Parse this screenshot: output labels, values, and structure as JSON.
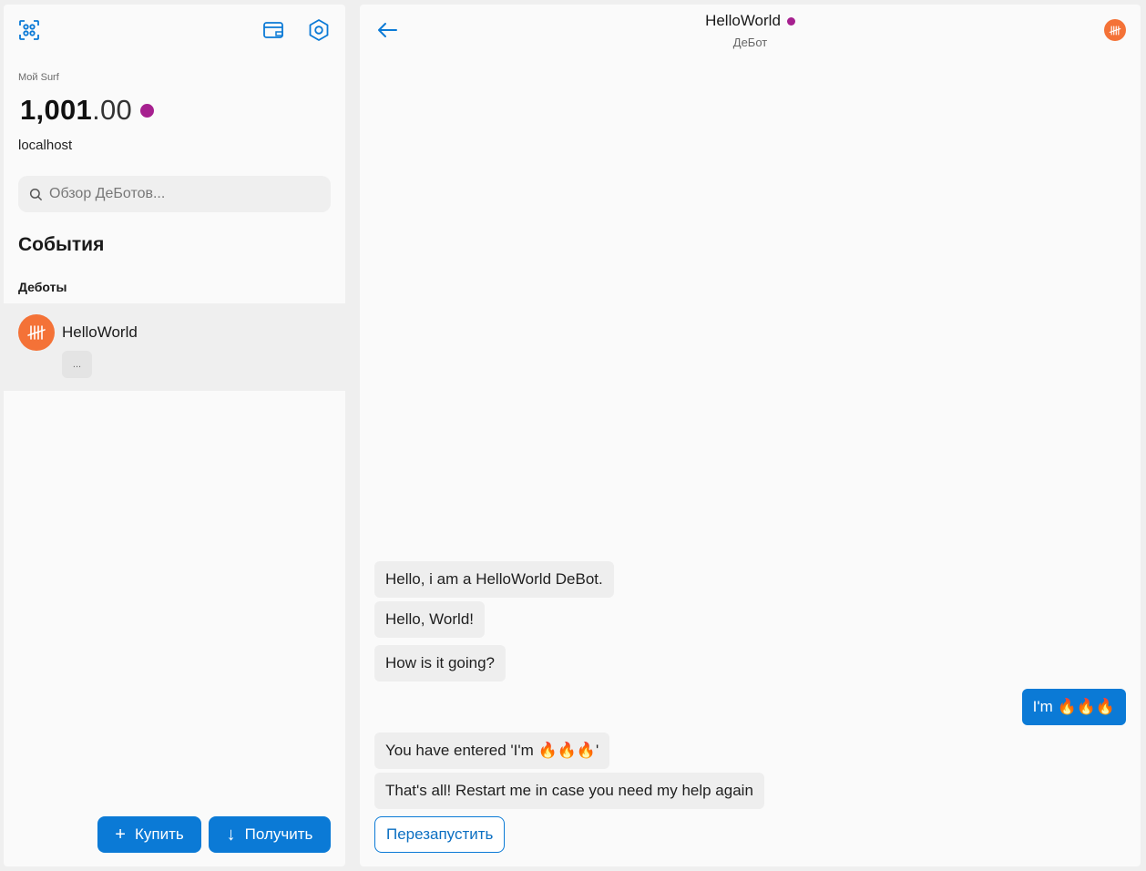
{
  "sidebar": {
    "my_surf_label": "Мой Surf",
    "balance_int": "1,001",
    "balance_dec": ".00",
    "network": "localhost",
    "search_placeholder": "Обзор ДеБотов...",
    "events_title": "События",
    "debots_label": "Деботы",
    "debots": [
      {
        "name": "HelloWorld",
        "preview": "...",
        "avatar_icon": "tally-icon"
      }
    ],
    "buy_label": "Купить",
    "receive_label": "Получить",
    "icons": [
      "qr-scan-icon",
      "wallet-icon",
      "settings-icon",
      "search-icon",
      "plus-icon",
      "arrow-down-icon"
    ]
  },
  "chat": {
    "title": "HelloWorld",
    "subtitle": "ДеБот",
    "messages": [
      {
        "from": "bot",
        "text": "Hello, i am a HelloWorld DeBot."
      },
      {
        "from": "bot",
        "text": "Hello, World!"
      },
      {
        "from": "bot",
        "text": "How is it going?"
      },
      {
        "from": "user",
        "text": "I'm 🔥🔥🔥"
      },
      {
        "from": "bot",
        "text": "You have entered 'I'm 🔥🔥🔥'"
      },
      {
        "from": "bot",
        "text": "That's all! Restart me in case you need my help again"
      }
    ],
    "restart_label": "Перезапустить",
    "icons": [
      "back-arrow-icon",
      "debot-avatar-icon"
    ]
  },
  "colors": {
    "accent": "#0b7ad6",
    "status_dot": "#a6208f",
    "debot_avatar": "#f47237"
  }
}
